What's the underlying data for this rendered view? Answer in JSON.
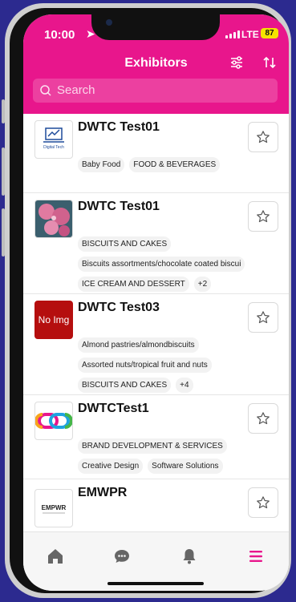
{
  "status": {
    "time": "10:00",
    "network": "LTE",
    "battery": "87"
  },
  "header": {
    "title": "Exhibitors",
    "filter_icon": "filter-icon",
    "sort_icon": "sort-icon"
  },
  "search": {
    "placeholder": "Search"
  },
  "exhibitors": [
    {
      "name": "DWTC Test01",
      "logo_text": "Digital Tech",
      "tags": [
        "Baby Food",
        "FOOD & BEVERAGES"
      ]
    },
    {
      "name": "DWTC Test01",
      "tags": [
        "BISCUITS AND CAKES",
        "Biscuits assortments/chocolate coated biscui",
        "ICE CREAM AND DESSERT",
        "+2"
      ]
    },
    {
      "name": "DWTC Test03",
      "logo_text": "No Img",
      "tags": [
        "Almond pastries/almondbiscuits",
        "Assorted nuts/tropical fruit and nuts",
        "BISCUITS AND CAKES",
        "+4"
      ]
    },
    {
      "name": "DWTCTest1",
      "tags": [
        "BRAND DEVELOPMENT & SERVICES",
        "Creative Design",
        "Software Solutions"
      ]
    },
    {
      "name": "EMWPR",
      "logo_text": "EMPWR",
      "tags": []
    }
  ],
  "tabbar": {
    "items": [
      "home-icon",
      "chat-icon",
      "bell-icon",
      "menu-icon"
    ],
    "active": "menu-icon",
    "accent": "#e8168c"
  },
  "colors": {
    "brand": "#e8168c",
    "background": "#2c2a8f"
  }
}
